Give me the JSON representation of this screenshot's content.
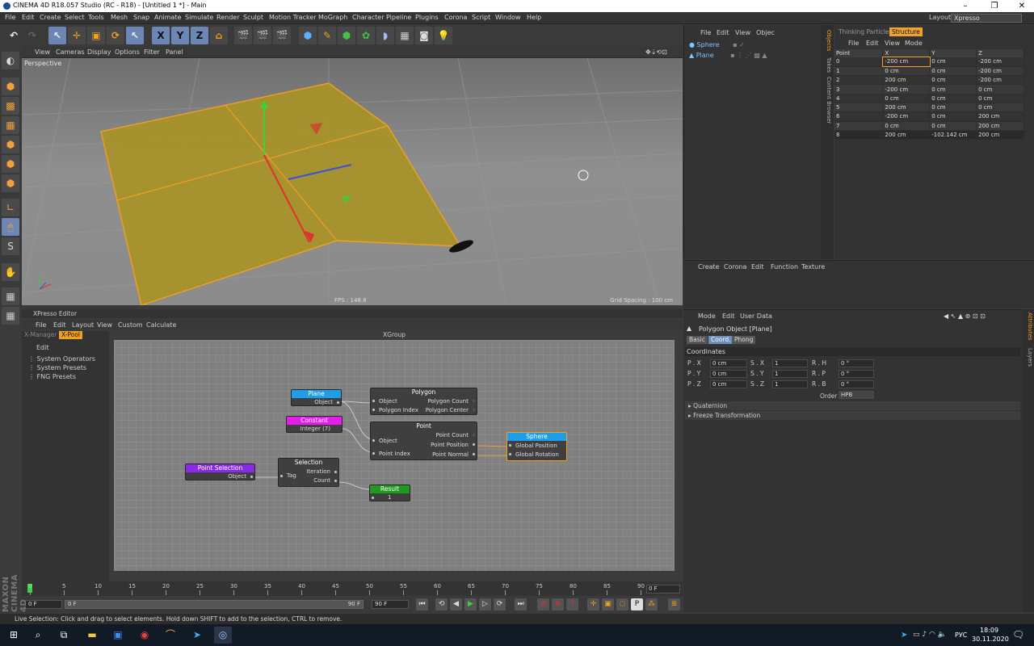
{
  "window": {
    "title": "CINEMA 4D R18.057 Studio (RC - R18) - [Untitled 1 *] - Main",
    "controls": [
      "–",
      "❐",
      "✕"
    ]
  },
  "menu": [
    "File",
    "Edit",
    "Create",
    "Select",
    "Tools",
    "Mesh",
    "Snap",
    "Animate",
    "Simulate",
    "Render",
    "Sculpt",
    "Motion Tracker",
    "MoGraph",
    "Character",
    "Pipeline",
    "Plugins",
    "Corona",
    "Script",
    "Window",
    "Help"
  ],
  "layout": {
    "label": "Layout:",
    "value": "Xpresso"
  },
  "toolbar": {
    "undo": "↶",
    "redo": "↷",
    "axes": [
      "X",
      "Y",
      "Z"
    ]
  },
  "viewport": {
    "menu": [
      "View",
      "Cameras",
      "Display",
      "Options",
      "Filter",
      "Panel"
    ],
    "label": "Perspective",
    "fps": "FPS : 148.8",
    "grid_spacing": "Grid Spacing : 100 cm",
    "plane_color": "#a89224",
    "edge_color": "#f0a020"
  },
  "object_manager": {
    "menu": [
      "File",
      "Edit",
      "View",
      "Objec"
    ],
    "objects": [
      {
        "name": "Sphere"
      },
      {
        "name": "Plane"
      }
    ]
  },
  "side_tabs": [
    "Objects",
    "Takes",
    "Content Browser"
  ],
  "structure": {
    "tabs": [
      "Thinking Particles",
      "Structure"
    ],
    "menu": [
      "File",
      "Edit",
      "View",
      "Mode"
    ],
    "columns": [
      "Point",
      "X",
      "Y",
      "Z"
    ],
    "rows": [
      [
        "0",
        "-200 cm",
        "0 cm",
        "-200 cm"
      ],
      [
        "1",
        "0 cm",
        "0 cm",
        "-200 cm"
      ],
      [
        "2",
        "200 cm",
        "0 cm",
        "-200 cm"
      ],
      [
        "3",
        "-200 cm",
        "0 cm",
        "0 cm"
      ],
      [
        "4",
        "0 cm",
        "0 cm",
        "0 cm"
      ],
      [
        "5",
        "200 cm",
        "0 cm",
        "0 cm"
      ],
      [
        "6",
        "-200 cm",
        "0 cm",
        "200 cm"
      ],
      [
        "7",
        "0 cm",
        "0 cm",
        "200 cm"
      ],
      [
        "8",
        "200 cm",
        "-102.142 cm",
        "200 cm"
      ]
    ]
  },
  "material_manager": {
    "menu": [
      "Create",
      "Corona",
      "Edit",
      "Function",
      "Texture"
    ]
  },
  "attributes": {
    "menu": [
      "Mode",
      "Edit",
      "User Data"
    ],
    "object_title": "Polygon Object [Plane]",
    "tabs": [
      "Basic",
      "Coord.",
      "Phong"
    ],
    "section": "Coordinates",
    "rows": [
      {
        "p_label": "P . X",
        "p_val": "0 cm",
        "s_label": "S . X",
        "s_val": "1",
        "r_label": "R . H",
        "r_val": "0 °"
      },
      {
        "p_label": "P . Y",
        "p_val": "0 cm",
        "s_label": "S . Y",
        "s_val": "1",
        "r_label": "R . P",
        "r_val": "0 °"
      },
      {
        "p_label": "P . Z",
        "p_val": "0 cm",
        "s_label": "S . Z",
        "s_val": "1",
        "r_label": "R . B",
        "r_val": "0 °"
      }
    ],
    "order_label": "Order",
    "order_value": "HPB",
    "folds": [
      "Quaternion",
      "Freeze Transformation"
    ],
    "side_tabs": [
      "Attributes",
      "Layers"
    ]
  },
  "xpresso": {
    "title": "XPresso Editor",
    "menu": [
      "File",
      "Edit",
      "Layout",
      "View",
      "Custom",
      "Calculate"
    ],
    "left_tabs": [
      "X-Manager",
      "X-Pool"
    ],
    "left_edit": "Edit",
    "pool": [
      "System Operators",
      "System Presets",
      "FNG Presets"
    ],
    "group": "XGroup",
    "nodes": {
      "plane": {
        "title": "Plane",
        "out": "Object"
      },
      "constant": {
        "title": "Constant",
        "out": "Integer (7)"
      },
      "point_selection": {
        "title": "Point Selection",
        "out": "Object"
      },
      "selection": {
        "title": "Selection",
        "in": "Tag",
        "out1": "Iteration",
        "out2": "Count"
      },
      "polygon": {
        "title": "Polygon",
        "in1": "Object",
        "in2": "Polygon Index",
        "out1": "Polygon Count",
        "out2": "Polygon Center"
      },
      "point": {
        "title": "Point",
        "in1": "Object",
        "in2": "Point Index",
        "out1": "Point Count",
        "out2": "Point Position",
        "out3": "Point Normal"
      },
      "sphere": {
        "title": "Sphere",
        "in1": "Global Position",
        "in2": "Global Rotation"
      },
      "result": {
        "title": "Result",
        "value": "1"
      }
    }
  },
  "timeline": {
    "ticks": [
      "0",
      "5",
      "10",
      "15",
      "20",
      "25",
      "30",
      "35",
      "40",
      "45",
      "50",
      "55",
      "60",
      "65",
      "70",
      "75",
      "80",
      "85",
      "90"
    ],
    "current_frame": "0 F",
    "start": "0 F",
    "range_left": "0 F",
    "range_right": "90 F",
    "end": "90 F"
  },
  "status": "Live Selection: Click and drag to select elements. Hold down SHIFT to add to the selection, CTRL to remove.",
  "brand": "MAXON CINEMA 4D",
  "taskbar": {
    "lang": "РУС",
    "time": "18:09",
    "date": "30.11.2020"
  }
}
